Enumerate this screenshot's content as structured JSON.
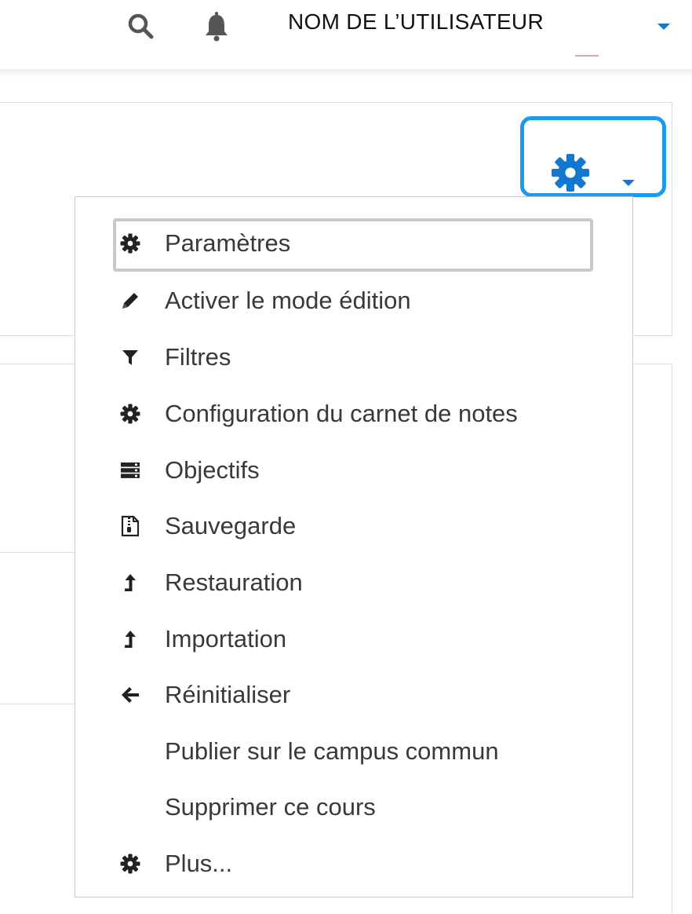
{
  "navbar": {
    "username": "NOM DE L’UTILISATEUR",
    "icons": [
      "search-icon",
      "bell-icon",
      "caret-down-icon"
    ],
    "caret_color": "#1177d1"
  },
  "gear_menu": {
    "trigger_icon": "gear-icon",
    "trigger_color": "#1177d1",
    "highlight_color": "#1a9bf0",
    "items": [
      {
        "label": "Paramètres",
        "icon": "gear-icon",
        "focused": true
      },
      {
        "label": "Activer le mode édition",
        "icon": "pencil-icon"
      },
      {
        "label": "Filtres",
        "icon": "filter-icon"
      },
      {
        "label": "Configuration du carnet de notes",
        "icon": "gear-icon"
      },
      {
        "label": "Objectifs",
        "icon": "server-icon"
      },
      {
        "label": "Sauvegarde",
        "icon": "file-archive-icon"
      },
      {
        "label": "Restauration",
        "icon": "level-up-icon"
      },
      {
        "label": "Importation",
        "icon": "level-up-icon"
      },
      {
        "label": "Réinitialiser",
        "icon": "arrow-left-icon"
      },
      {
        "label": "Publier sur le campus commun",
        "icon": ""
      },
      {
        "label": "Supprimer ce cours",
        "icon": ""
      },
      {
        "label": "Plus...",
        "icon": "gear-icon"
      }
    ]
  }
}
